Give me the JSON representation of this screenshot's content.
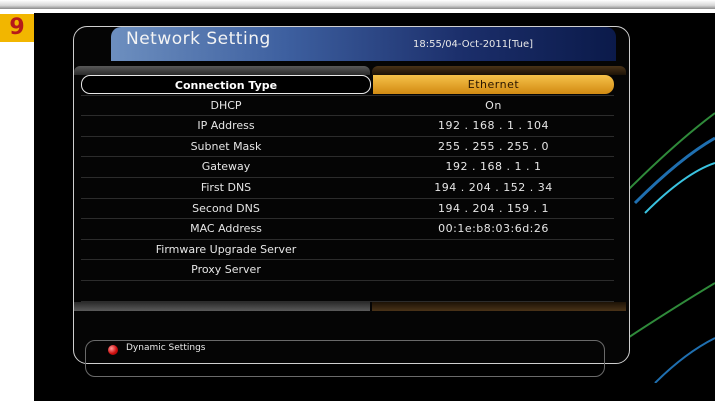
{
  "step_number": "9",
  "header": {
    "title": "Network Setting",
    "datetime": "18:55/04-Oct-2011[Tue]"
  },
  "rows": [
    {
      "label": "Connection Type",
      "value": "Ethernet"
    },
    {
      "label": "DHCP",
      "value": "On"
    },
    {
      "label": "IP Address",
      "value": "192 . 168 . 1 . 104"
    },
    {
      "label": "Subnet Mask",
      "value": "255 . 255 . 255 . 0"
    },
    {
      "label": "Gateway",
      "value": "192 . 168 . 1 . 1"
    },
    {
      "label": "First DNS",
      "value": "194 . 204 . 152 . 34"
    },
    {
      "label": "Second DNS",
      "value": "194 . 204 . 159 . 1"
    },
    {
      "label": "MAC Address",
      "value": "00:1e:b8:03:6d:26"
    },
    {
      "label": "Firmware Upgrade Server",
      "value": ""
    },
    {
      "label": "Proxy Server",
      "value": ""
    }
  ],
  "footer": {
    "button_color": "red",
    "label": "Dynamic Settings"
  },
  "colors": {
    "selected_value_bg": "#e9a82a",
    "title_bar": "#3d5f9f",
    "step_badge": "#f2b600"
  }
}
